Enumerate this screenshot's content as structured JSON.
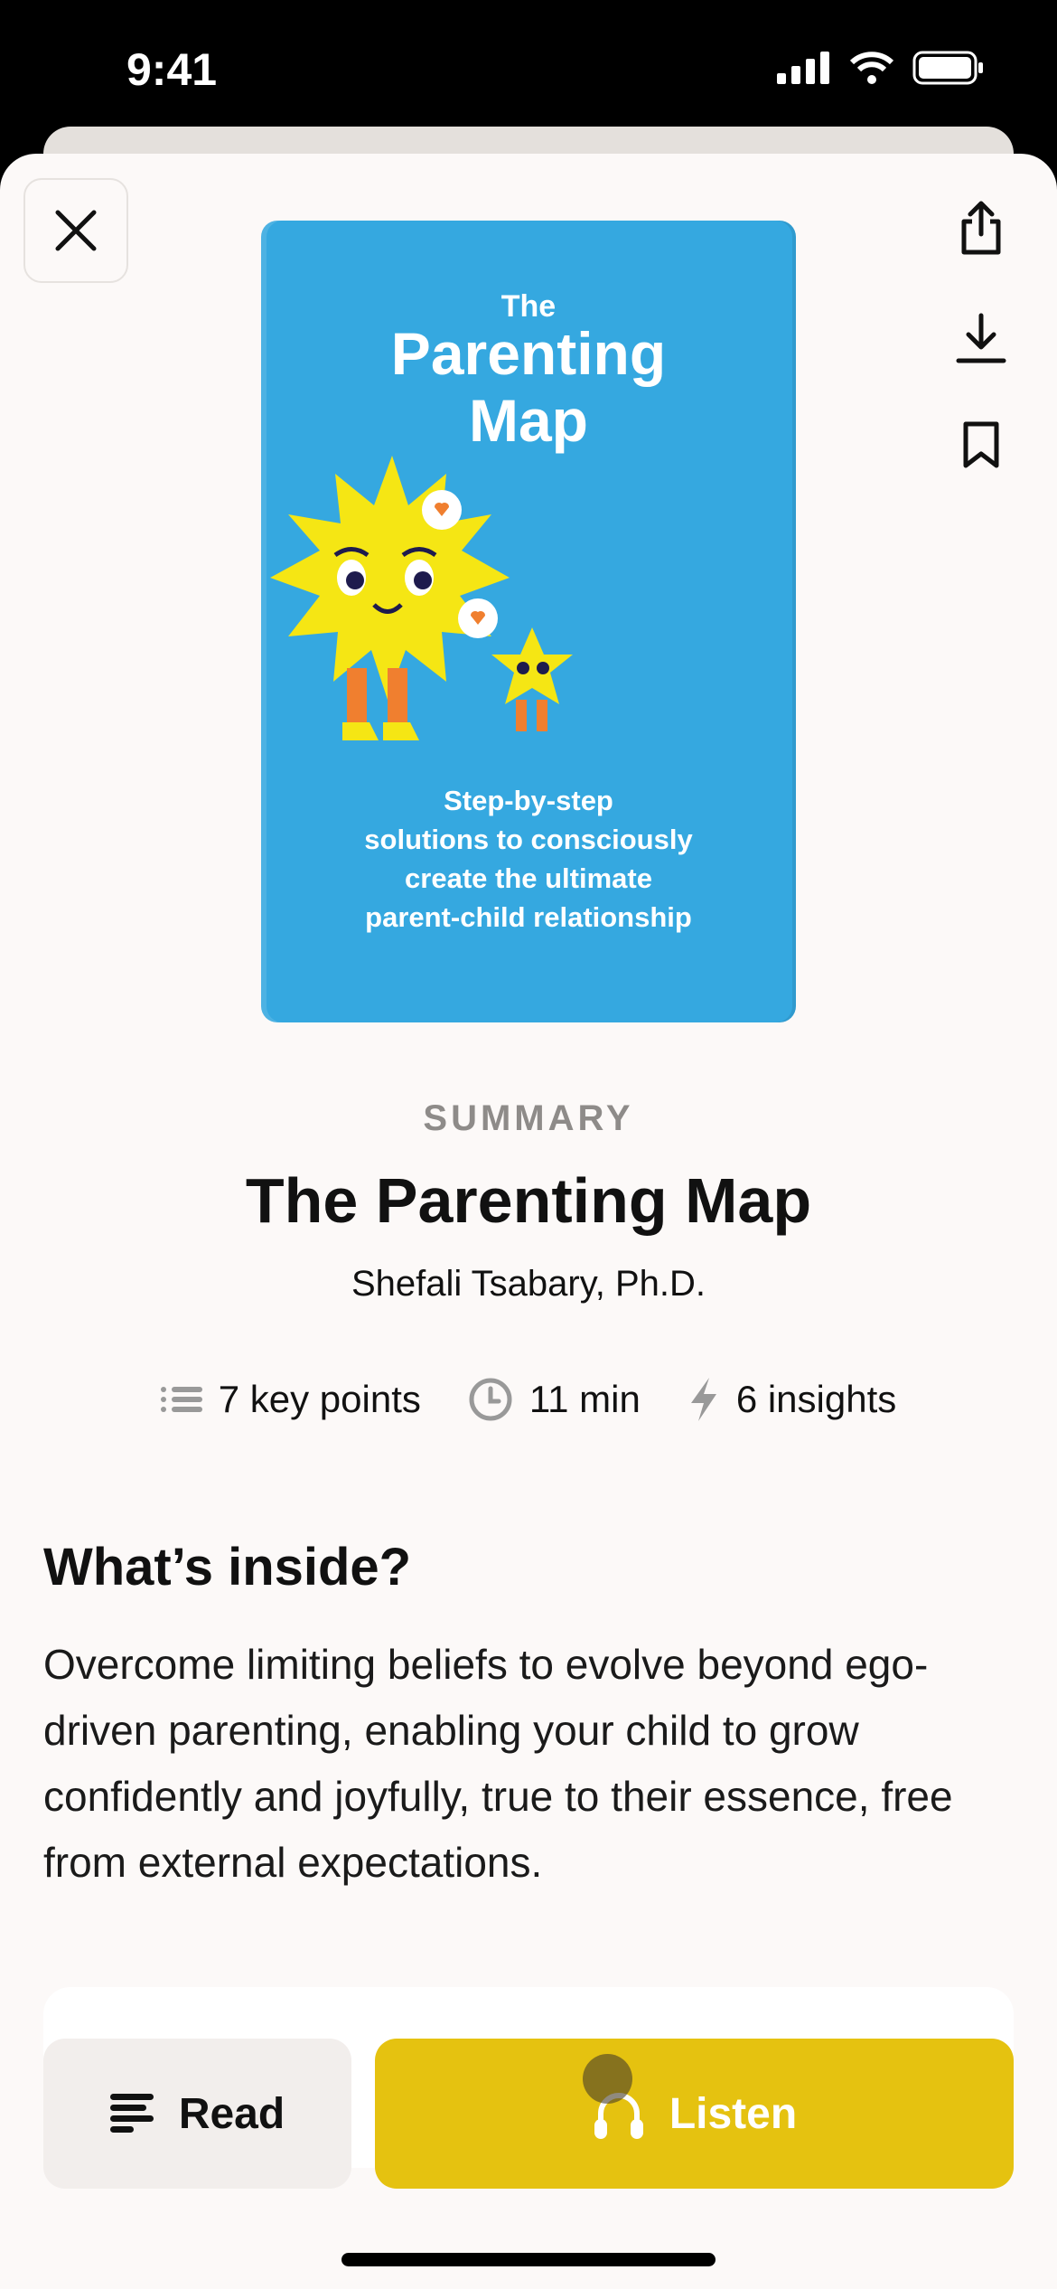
{
  "status_bar": {
    "time": "9:41"
  },
  "book": {
    "cover": {
      "the": "The",
      "title_line1": "Parenting",
      "title_line2": "Map",
      "subtitle_lines": [
        "Step-by-step",
        "solutions to consciously",
        "create the ultimate",
        "parent-child relationship"
      ],
      "color": "#35a8e0"
    },
    "label": "SUMMARY",
    "title": "The Parenting Map",
    "author": "Shefali Tsabary, Ph.D.",
    "stats": [
      {
        "icon": "list-icon",
        "text": "7 key points"
      },
      {
        "icon": "clock-icon",
        "text": "11 min"
      },
      {
        "icon": "bolt-icon",
        "text": "6 insights"
      }
    ]
  },
  "inside": {
    "heading": "What’s inside?",
    "text": "Overcome limiting beliefs to evolve beyond ego-driven parenting, enabling your child to grow confidently and joyfully, true to their essence, free from external expectations."
  },
  "actions": {
    "read": "Read",
    "listen": "Listen",
    "accent": "#e5c210"
  }
}
